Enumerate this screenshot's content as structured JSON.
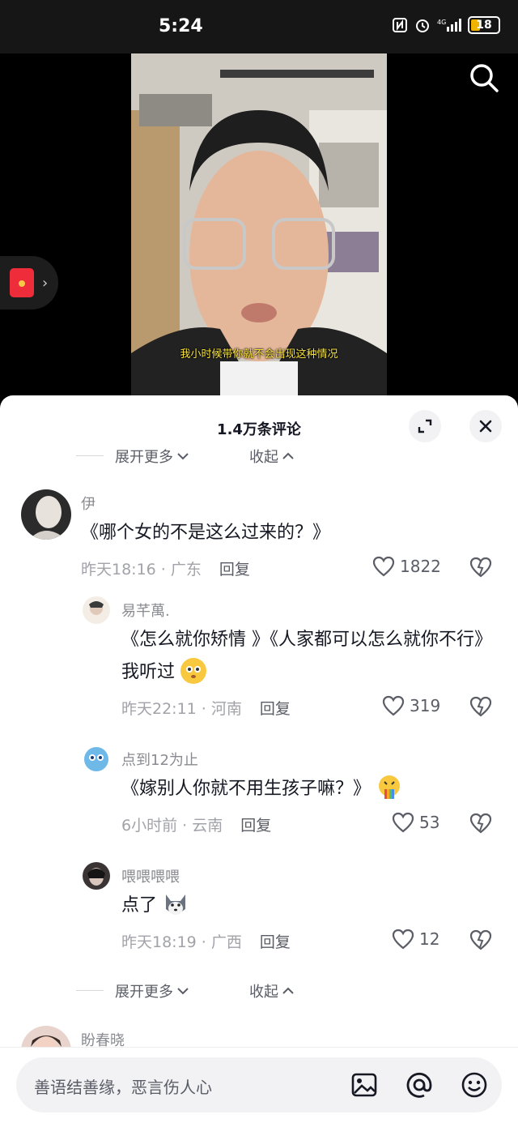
{
  "status_bar": {
    "time": "5:24",
    "battery": "18",
    "network": "4G"
  },
  "video": {
    "subtitle": "我小时候带你就不会出现这种情况"
  },
  "sheet": {
    "title": "1.4万条评论",
    "expand_more": "展开更多",
    "collapse": "收起"
  },
  "comments": [
    {
      "username": "伊",
      "text": "《哪个女的不是这么过来的？》",
      "time": "昨天18:16",
      "location": "广东",
      "reply": "回复",
      "likes": "1822"
    },
    {
      "username": "易芊萬.",
      "text": "《怎么就你矫情 》《人家都可以怎么就你不行》 我听过",
      "time": "昨天22:11",
      "location": "河南",
      "reply": "回复",
      "likes": "319"
    },
    {
      "username": "点到12为止",
      "text": "《嫁别人你就不用生孩子嘛？》",
      "time": "6小时前",
      "location": "云南",
      "reply": "回复",
      "likes": "53"
    },
    {
      "username": "喂喂喂喂",
      "text": "点了",
      "time": "昨天18:19",
      "location": "广西",
      "reply": "回复",
      "likes": "12"
    },
    {
      "username": "盼春晓"
    }
  ],
  "input": {
    "placeholder": "善语结善缘，恶言伤人心"
  },
  "colors": {
    "accent_red": "#ef2d3a",
    "subtitle_yellow": "#f7e33b"
  }
}
